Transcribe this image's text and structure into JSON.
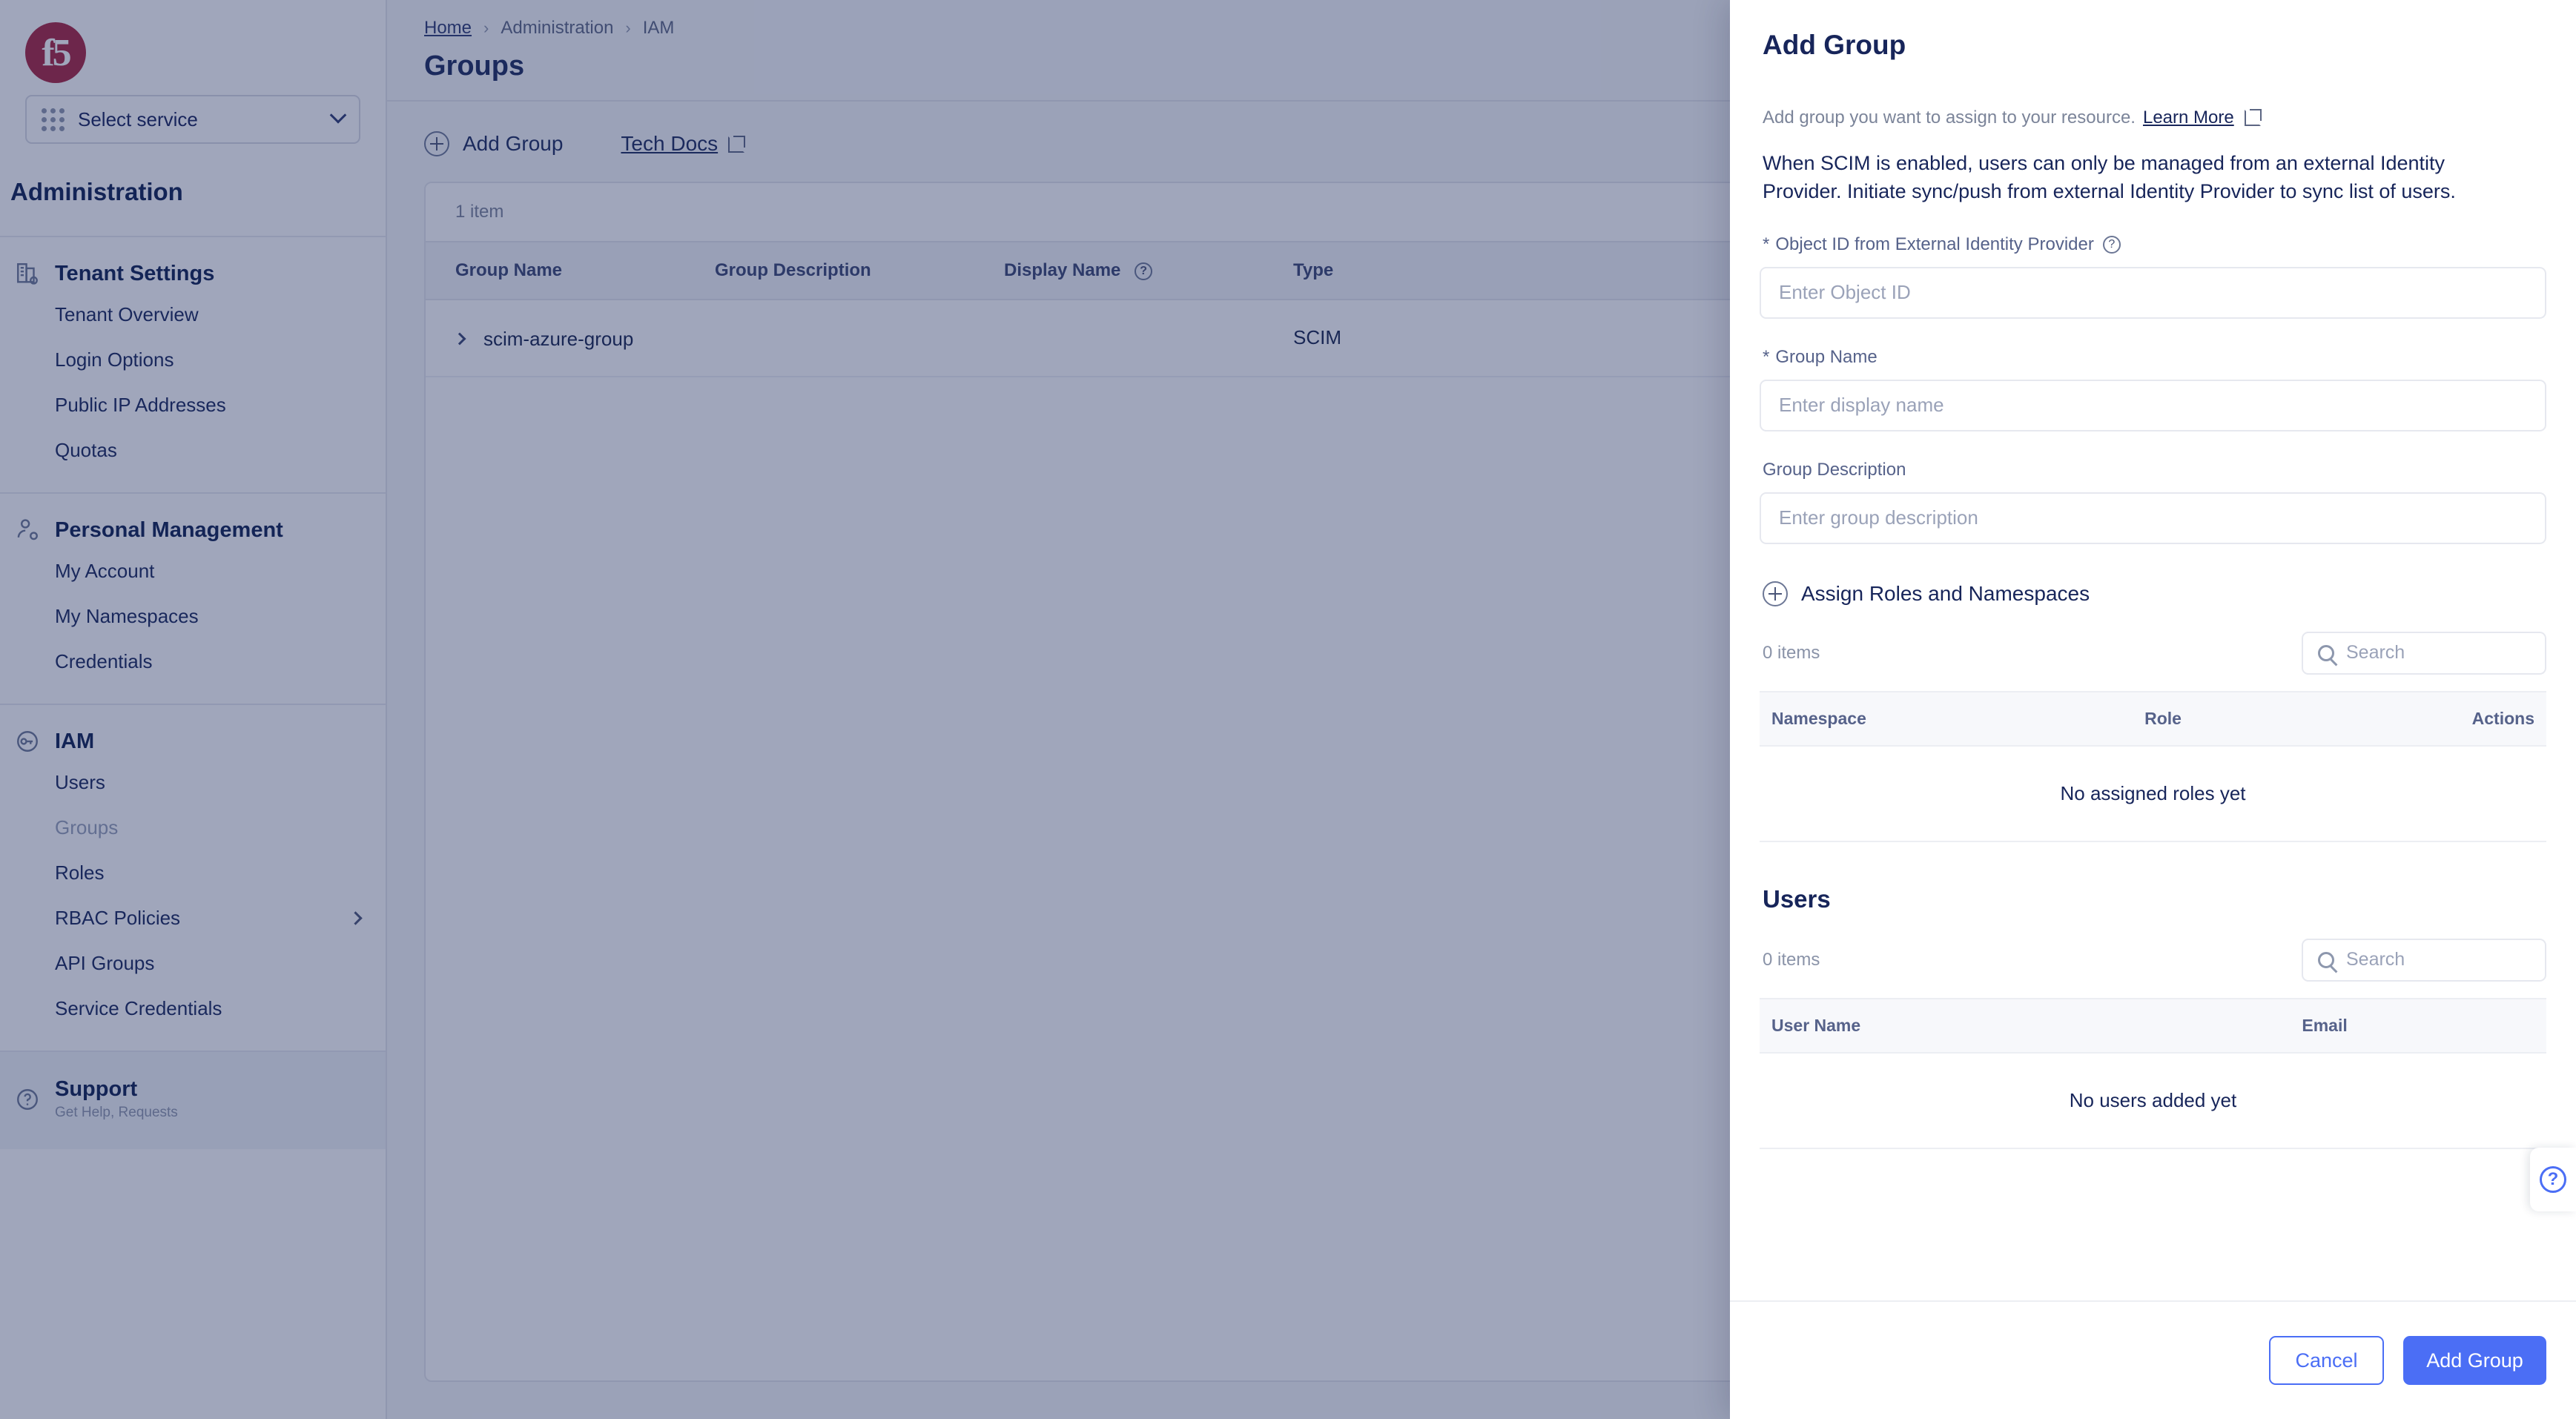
{
  "brand": {
    "logo_text": "f5",
    "accent": "#a8243f",
    "primary": "#4b6ef5"
  },
  "sidebar": {
    "service_selector": {
      "label": "Select service",
      "icon": "grid-icon",
      "chevron": "chevron-down-icon"
    },
    "section_title": "Administration",
    "groups": [
      {
        "head": "Tenant Settings",
        "icon": "building-settings-icon",
        "items": [
          {
            "label": "Tenant Overview",
            "muted": false,
            "chevron": false
          },
          {
            "label": "Login Options",
            "muted": false,
            "chevron": false
          },
          {
            "label": "Public IP Addresses",
            "muted": false,
            "chevron": false
          },
          {
            "label": "Quotas",
            "muted": false,
            "chevron": false
          }
        ]
      },
      {
        "head": "Personal Management",
        "icon": "user-settings-icon",
        "items": [
          {
            "label": "My Account",
            "muted": false,
            "chevron": false
          },
          {
            "label": "My Namespaces",
            "muted": false,
            "chevron": false
          },
          {
            "label": "Credentials",
            "muted": false,
            "chevron": false
          }
        ]
      },
      {
        "head": "IAM",
        "icon": "key-circle-icon",
        "items": [
          {
            "label": "Users",
            "muted": false,
            "chevron": false
          },
          {
            "label": "Groups",
            "muted": true,
            "chevron": false
          },
          {
            "label": "Roles",
            "muted": false,
            "chevron": false
          },
          {
            "label": "RBAC Policies",
            "muted": false,
            "chevron": true
          },
          {
            "label": "API Groups",
            "muted": false,
            "chevron": false
          },
          {
            "label": "Service Credentials",
            "muted": false,
            "chevron": false
          }
        ]
      }
    ],
    "support": {
      "head": "Support",
      "sub": "Get Help, Requests",
      "icon": "question-circle-icon"
    }
  },
  "main": {
    "breadcrumb": [
      {
        "label": "Home",
        "link": true
      },
      {
        "label": "Administration",
        "link": false
      },
      {
        "label": "IAM",
        "link": false
      }
    ],
    "breadcrumb_separator": "›",
    "page_title": "Groups",
    "toolbar": {
      "add_group_label": "Add Group",
      "add_group_icon": "plus-circle-icon",
      "tech_docs_label": "Tech Docs",
      "tech_docs_icon": "external-link-icon"
    },
    "table": {
      "item_count": "1 item",
      "columns": [
        "Group Name",
        "Group Description",
        "Display Name",
        "Type"
      ],
      "display_name_tooltip_icon": "question-circle-icon",
      "rows": [
        {
          "expand_icon": "chevron-right-icon",
          "group_name": "scim-azure-group",
          "group_description": "",
          "display_name": "",
          "type": "SCIM"
        }
      ]
    }
  },
  "panel": {
    "title": "Add Group",
    "subtitle_text": "Add group you want to assign to your resource.",
    "subtitle_link": "Learn More",
    "subtitle_link_icon": "external-link-icon",
    "note": "When SCIM is enabled, users can only be managed from an external Identity Provider. Initiate sync/push from external Identity Provider to sync list of users.",
    "fields": [
      {
        "label": "Object ID from External Identity Provider",
        "required_marker": "*",
        "has_tooltip": true,
        "tooltip_icon": "question-circle-icon",
        "value": "",
        "placeholder": "Enter Object ID"
      },
      {
        "label": "Group Name",
        "required_marker": "*",
        "has_tooltip": false,
        "value": "",
        "placeholder": "Enter display name"
      },
      {
        "label": "Group Description",
        "required_marker": "",
        "has_tooltip": false,
        "value": "",
        "placeholder": "Enter group description"
      }
    ],
    "roles_section": {
      "add_button_label": "Assign Roles and Namespaces",
      "add_button_icon": "plus-circle-icon",
      "item_count": "0 items",
      "search_placeholder": "Search",
      "search_icon": "search-icon",
      "columns": [
        "Namespace",
        "Role",
        "Actions"
      ],
      "empty_message": "No assigned roles yet"
    },
    "users_section": {
      "title": "Users",
      "item_count": "0 items",
      "search_placeholder": "Search",
      "search_icon": "search-icon",
      "columns": [
        "User Name",
        "Email"
      ],
      "empty_message": "No users added yet"
    },
    "footer": {
      "cancel_label": "Cancel",
      "submit_label": "Add Group"
    }
  },
  "help_fab": {
    "icon": "question-circle-icon",
    "glyph": "?"
  }
}
